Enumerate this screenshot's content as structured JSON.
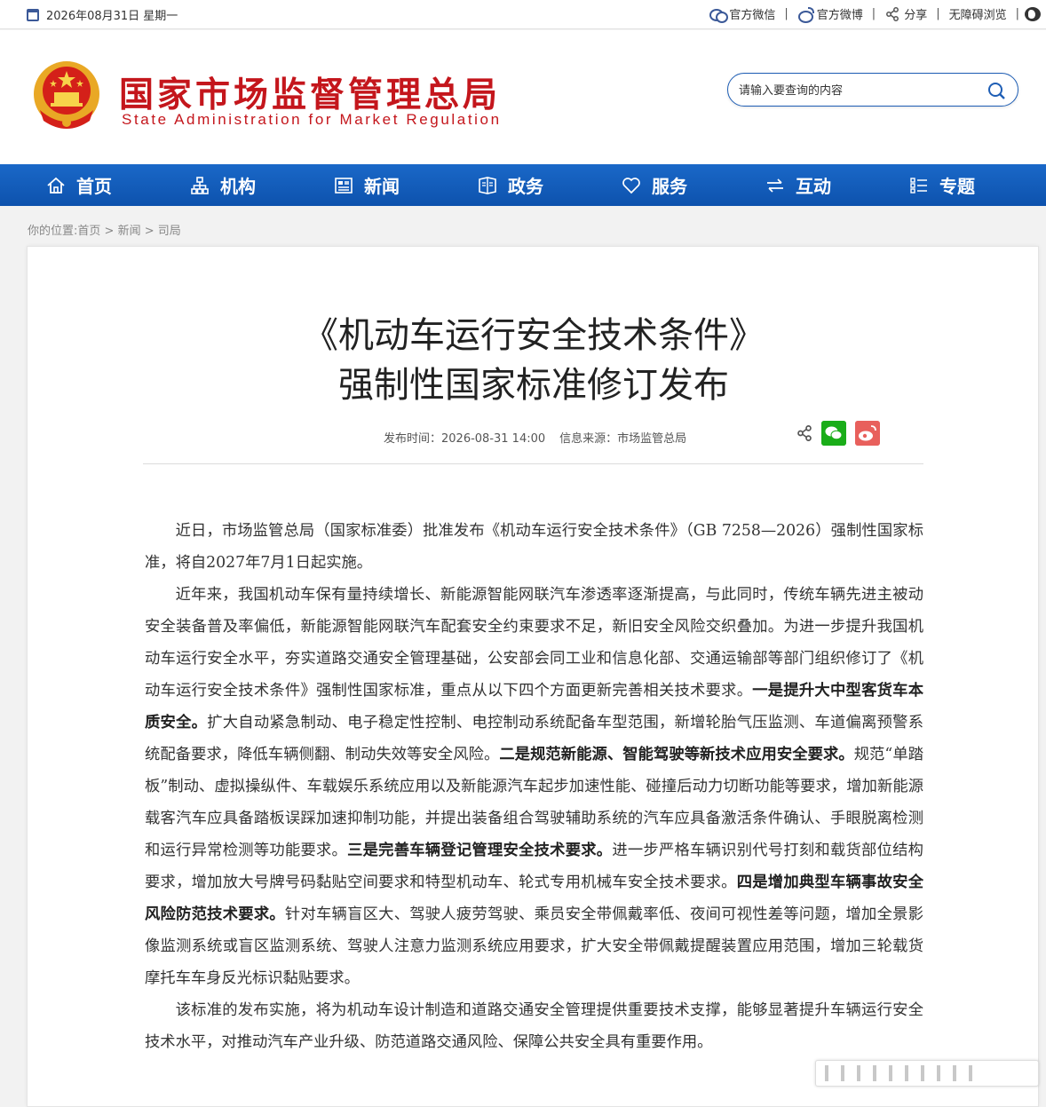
{
  "topbar": {
    "date": "2026年08月31日 星期一",
    "links": [
      {
        "label": "官方微信",
        "icon": "wechat-icon"
      },
      {
        "label": "官方微博",
        "icon": "weibo-icon"
      },
      {
        "label": "分享",
        "icon": "share-icon"
      },
      {
        "label": "无障碍浏览",
        "icon": ""
      }
    ],
    "separator": "|"
  },
  "header": {
    "logo_cn": "国家市场监督管理总局",
    "logo_en": "State Administration for Market Regulation",
    "search_placeholder": "请输入要查询的内容"
  },
  "nav": {
    "items": [
      {
        "label": "首页",
        "icon": "home-icon"
      },
      {
        "label": "机构",
        "icon": "org-icon"
      },
      {
        "label": "新闻",
        "icon": "news-icon"
      },
      {
        "label": "政务",
        "icon": "gov-icon"
      },
      {
        "label": "服务",
        "icon": "heart-icon"
      },
      {
        "label": "互动",
        "icon": "exchange-icon"
      },
      {
        "label": "专题",
        "icon": "topics-icon"
      }
    ]
  },
  "breadcrumb": {
    "prefix": "你的位置:",
    "items": [
      "首页",
      "新闻",
      "司局"
    ],
    "sep": ">"
  },
  "article": {
    "title_line1": "《机动车运行安全技术条件》",
    "title_line2": "强制性国家标准修订发布",
    "publish_time": "发布时间：2026-08-31 14:00",
    "source": "信息来源：市场监管总局",
    "paragraphs": [
      [
        {
          "t": "近日，市场监管总局（国家标准委）批准发布《机动车运行安全技术条件》（GB 7258—2026）强制性国家标准，将自2027年7月1日起实施。"
        }
      ],
      [
        {
          "t": "近年来，我国机动车保有量持续增长、新能源智能网联汽车渗透率逐渐提高，与此同时，传统车辆先进主被动安全装备普及率偏低，新能源智能网联汽车配套安全约束要求不足，新旧安全风险交织叠加。为进一步提升我国机动车运行安全水平，夯实道路交通安全管理基础，公安部会同工业和信息化部、交通运输部等部门组织修订了《机动车运行安全技术条件》强制性国家标准，重点从以下四个方面更新完善相关技术要求。"
        },
        {
          "t": "一是提升大中型客货车本质安全。",
          "b": true
        },
        {
          "t": "扩大自动紧急制动、电子稳定性控制、电控制动系统配备车型范围，新增轮胎气压监测、车道偏离预警系统配备要求，降低车辆侧翻、制动失效等安全风险。"
        },
        {
          "t": "二是规范新能源、智能驾驶等新技术应用安全要求。",
          "b": true
        },
        {
          "t": "规范“单踏板”制动、虚拟操纵件、车载娱乐系统应用以及新能源汽车起步加速性能、碰撞后动力切断功能等要求，增加新能源载客汽车应具备踏板误踩加速抑制功能，并提出装备组合驾驶辅助系统的汽车应具备激活条件确认、手眼脱离检测和运行异常检测等功能要求。"
        },
        {
          "t": "三是完善车辆登记管理安全技术要求。",
          "b": true
        },
        {
          "t": "进一步严格车辆识别代号打刻和载货部位结构要求，增加放大号牌号码黏贴空间要求和特型机动车、轮式专用机械车安全技术要求。"
        },
        {
          "t": "四是增加典型车辆事故安全风险防范技术要求。",
          "b": true
        },
        {
          "t": "针对车辆盲区大、驾驶人疲劳驾驶、乘员安全带佩戴率低、夜间可视性差等问题，增加全景影像监测系统或盲区监测系统、驾驶人注意力监测系统应用要求，扩大安全带佩戴提醒装置应用范围，增加三轮载货摩托车车身反光标识黏贴要求。"
        }
      ],
      [
        {
          "t": "该标准的发布实施，将为机动车设计制造和道路交通安全管理提供重要技术支撑，能够显著提升车辆运行安全技术水平，对推动汽车产业升级、防范道路交通风险、保障公共安全具有重要作用。"
        }
      ]
    ]
  },
  "colors": {
    "brand_red": "#c4161c",
    "nav_blue": "#0d52ad",
    "wechat_green": "#1aad19",
    "weibo_red": "#e8605c"
  }
}
